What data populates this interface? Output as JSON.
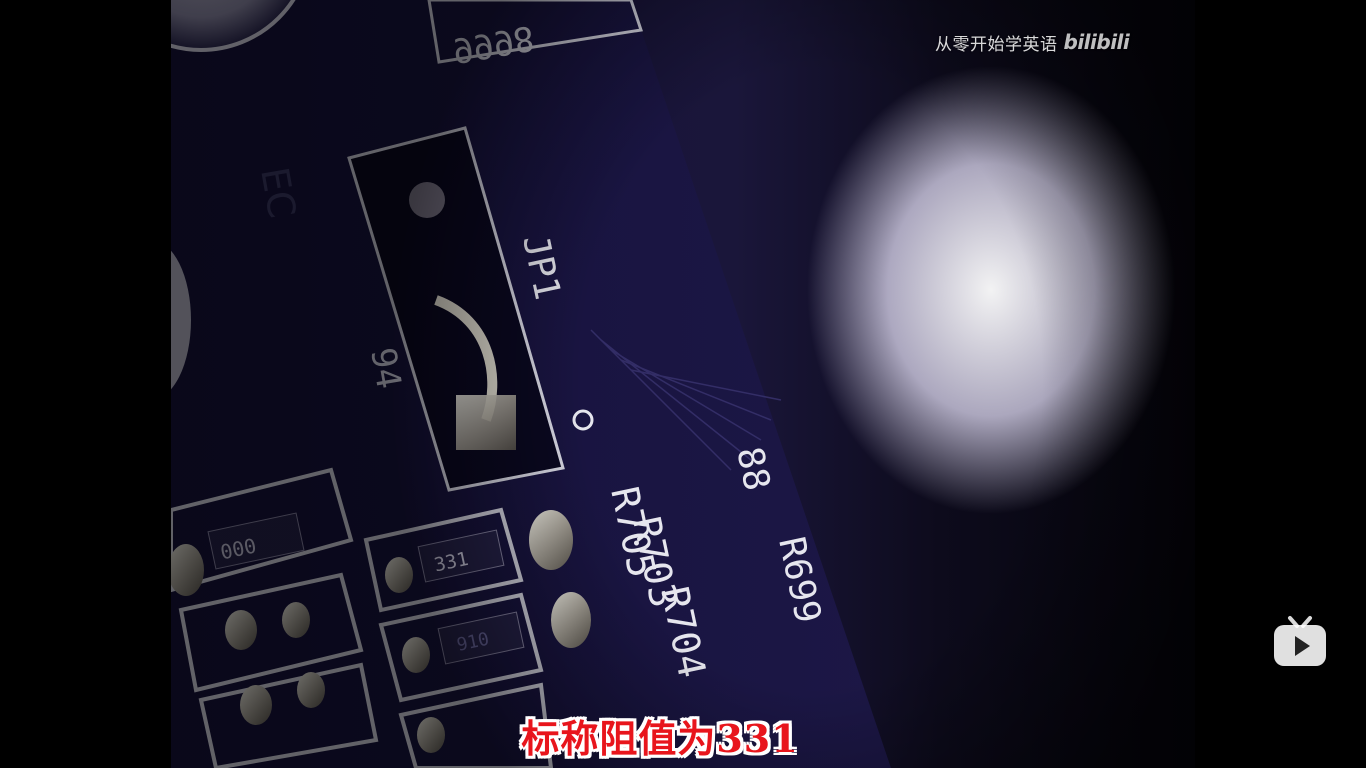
{
  "watermark": {
    "channel_name": "从零开始学英语",
    "platform_logo_text": "bilibili"
  },
  "subtitle": {
    "text": "标称阻值为331"
  },
  "video_frame": {
    "board_labels": {
      "top_number": "9998",
      "jumper_label": "JP1",
      "resistor_r705": "R705",
      "resistor_r703": "R703",
      "resistor_r704": "R704",
      "resistor_r699": "R699",
      "resistor_r88": "88",
      "side_label": "EC",
      "side_label_2": "94",
      "smd_code_1": "000",
      "smd_code_2": "331",
      "smd_code_3": "910"
    }
  },
  "controls": {
    "play_button_icon": "bilibili-tv-icon"
  },
  "colors": {
    "subtitle_fill": "#e8151c",
    "subtitle_outline": "#ffffff",
    "pcb_base": "#1a163a",
    "silkscreen": "#e6e6ee"
  }
}
